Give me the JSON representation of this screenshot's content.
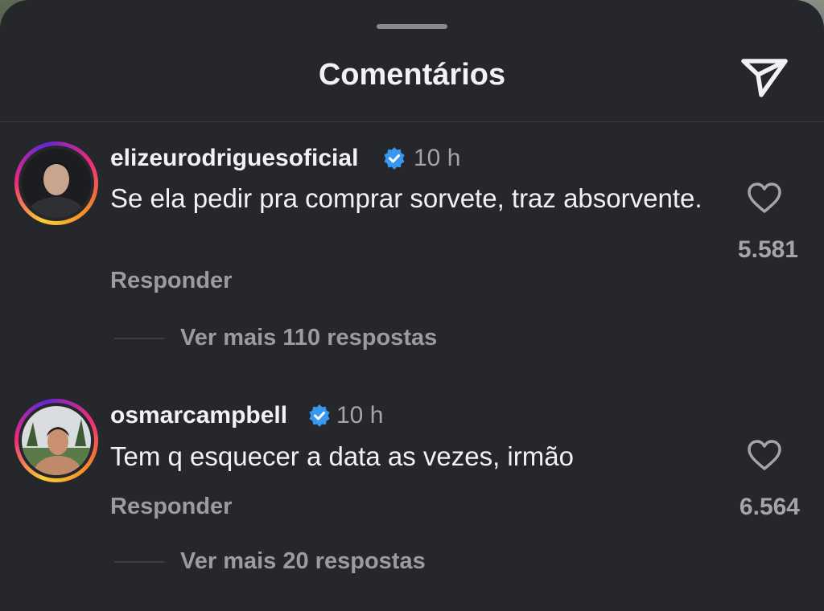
{
  "header": {
    "title": "Comentários",
    "send_icon": "send-paper-plane-icon"
  },
  "colors": {
    "background": "#26272b",
    "text": "#f2f2f4",
    "muted": "#9a9ca2",
    "verified": "#3897f0"
  },
  "comments": [
    {
      "username": "elizeurodriguesoficial",
      "verified": true,
      "time": "10 h",
      "text": "Se ela pedir pra comprar sorvete, traz absorvente.",
      "reply_label": "Responder",
      "likes": "5.581",
      "more_replies": "Ver mais 110 respostas"
    },
    {
      "username": "osmarcampbell",
      "verified": true,
      "time": "10 h",
      "text": "Tem q esquecer a data as vezes, irmão",
      "reply_label": "Responder",
      "likes": "6.564",
      "more_replies": "Ver mais 20 respostas"
    }
  ]
}
